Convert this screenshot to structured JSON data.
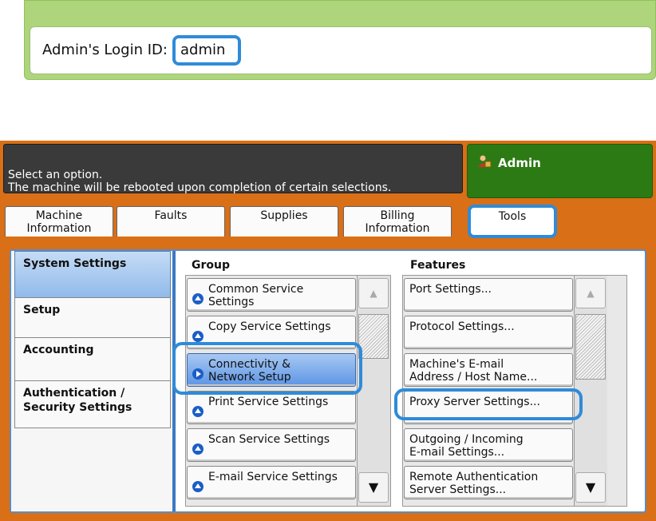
{
  "login": {
    "label": "Admin's Login ID:",
    "value": "admin"
  },
  "header": {
    "line1": "Select an option.",
    "line2": "The machine will be rebooted upon completion of certain selections."
  },
  "user": {
    "icon": "admin-user-icon",
    "label": "Admin"
  },
  "tabs": [
    {
      "line1": "Machine",
      "line2": "Information"
    },
    {
      "line1": "Faults",
      "line2": ""
    },
    {
      "line1": "Supplies",
      "line2": ""
    },
    {
      "line1": "Billing",
      "line2": "Information"
    },
    {
      "line1": "Tools",
      "line2": ""
    }
  ],
  "nav": [
    {
      "line1": "System Settings",
      "line2": ""
    },
    {
      "line1": "Setup",
      "line2": ""
    },
    {
      "line1": "Accounting",
      "line2": ""
    },
    {
      "line1": "Authentication /",
      "line2": "Security Settings"
    }
  ],
  "group": {
    "title": "Group",
    "items": [
      {
        "line1": "Common Service",
        "line2": "Settings"
      },
      {
        "line1": "Copy Service Settings",
        "line2": ""
      },
      {
        "line1": "Connectivity &",
        "line2": "Network Setup"
      },
      {
        "line1": "Print Service Settings",
        "line2": ""
      },
      {
        "line1": "Scan Service Settings",
        "line2": ""
      },
      {
        "line1": "E-mail Service Settings",
        "line2": ""
      }
    ]
  },
  "features": {
    "title": "Features",
    "items": [
      {
        "line1": "Port Settings...",
        "line2": ""
      },
      {
        "line1": "Protocol Settings...",
        "line2": ""
      },
      {
        "line1": "Machine's E-mail",
        "line2": "Address / Host Name..."
      },
      {
        "line1": "Proxy Server Settings...",
        "line2": ""
      },
      {
        "line1": "Outgoing / Incoming",
        "line2": "E-mail Settings..."
      },
      {
        "line1": "Remote Authentication",
        "line2": "Server Settings..."
      }
    ]
  },
  "scroll": {
    "up_symbol": "▲",
    "down_symbol": "▼"
  },
  "colors": {
    "panel_orange": "#d96f16",
    "highlight_blue": "#2f8bd9",
    "user_green": "#2c7a13",
    "login_green": "#aed57c"
  }
}
